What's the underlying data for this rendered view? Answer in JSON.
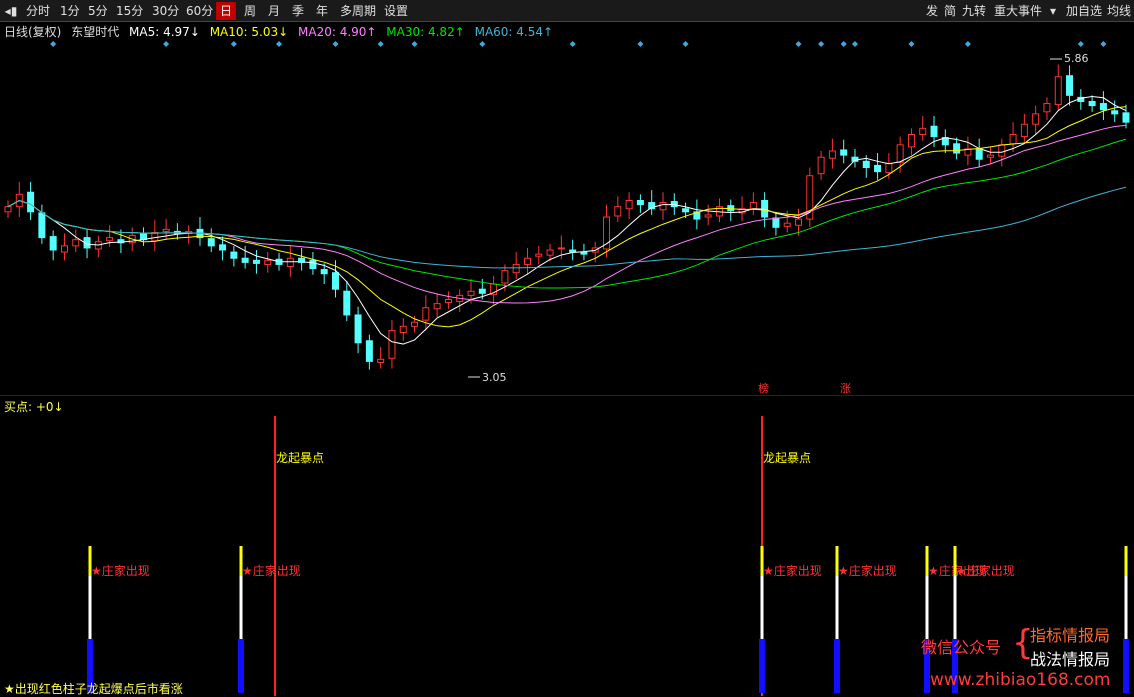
{
  "toolbar": {
    "back_icon": "back-arrow-icon",
    "periods": [
      "分时",
      "1分",
      "5分",
      "15分",
      "30分",
      "60分",
      "日",
      "周",
      "月",
      "季",
      "年",
      "多周期",
      "设置"
    ],
    "active_period": "日",
    "right_buttons": [
      "发",
      "简",
      "九转",
      "重大事件"
    ],
    "dropdown_icon": "dropdown-arrow-icon",
    "add_watch": "加自选",
    "cost_line": "均线"
  },
  "info": {
    "chart_type": "日线(复权)",
    "stock_name": "东望时代",
    "ma5": "MA5: 4.97↓",
    "ma10": "MA10: 5.03↓",
    "ma20": "MA20: 4.90↑",
    "ma30": "MA30: 4.82↑",
    "ma60": "MA60: 4.54↑"
  },
  "colors": {
    "up": "#ff3232",
    "down": "#54ffff",
    "ma5": "#ffffff",
    "ma10": "#ffff00",
    "ma20": "#ff80ff",
    "ma30": "#00e600",
    "ma60": "#3fb5d5",
    "diamond": "#3fa8e0"
  },
  "price_high_label": "5.86",
  "price_low_label": "3.05",
  "event_markers": [
    "榜",
    "涨"
  ],
  "sub_panel": {
    "title": "买点: +0↓",
    "signal_dragon": "龙起暴点",
    "signal_banker": "★庄家出现",
    "legend": "★出现红色柱子龙起爆点后市看涨"
  },
  "watermark": {
    "wechat": "微信公众号",
    "line1": "指标情报局",
    "line2": "战法情报局",
    "url": "www.zhibiao168.com"
  },
  "chart_data": {
    "type": "candlestick",
    "series_close": [
      4.6,
      4.72,
      4.55,
      4.3,
      4.18,
      4.22,
      4.28,
      4.2,
      4.26,
      4.3,
      4.25,
      4.32,
      4.28,
      4.35,
      4.38,
      4.34,
      4.36,
      4.3,
      4.22,
      4.18,
      4.1,
      4.06,
      4.05,
      4.08,
      4.04,
      4.1,
      4.06,
      4.0,
      3.95,
      3.8,
      3.55,
      3.28,
      3.1,
      3.12,
      3.4,
      3.44,
      3.48,
      3.62,
      3.66,
      3.7,
      3.74,
      3.78,
      3.76,
      3.85,
      3.98,
      4.04,
      4.1,
      4.14,
      4.18,
      4.2,
      4.16,
      4.14,
      4.2,
      4.5,
      4.6,
      4.66,
      4.62,
      4.58,
      4.64,
      4.6,
      4.55,
      4.48,
      4.52,
      4.6,
      4.56,
      4.58,
      4.64,
      4.5,
      4.4,
      4.44,
      4.48,
      4.9,
      5.08,
      5.14,
      5.1,
      5.04,
      4.98,
      4.94,
      5.02,
      5.2,
      5.3,
      5.36,
      5.28,
      5.2,
      5.12,
      5.16,
      5.06,
      5.1,
      5.2,
      5.3,
      5.4,
      5.5,
      5.6,
      5.86,
      5.68,
      5.62,
      5.58,
      5.54,
      5.5,
      5.42
    ],
    "ylim": [
      2.9,
      6.1
    ],
    "signals_dragon_index": [
      27,
      76
    ],
    "signals_banker_index": [
      9,
      24,
      76,
      84,
      93,
      96,
      112
    ]
  }
}
